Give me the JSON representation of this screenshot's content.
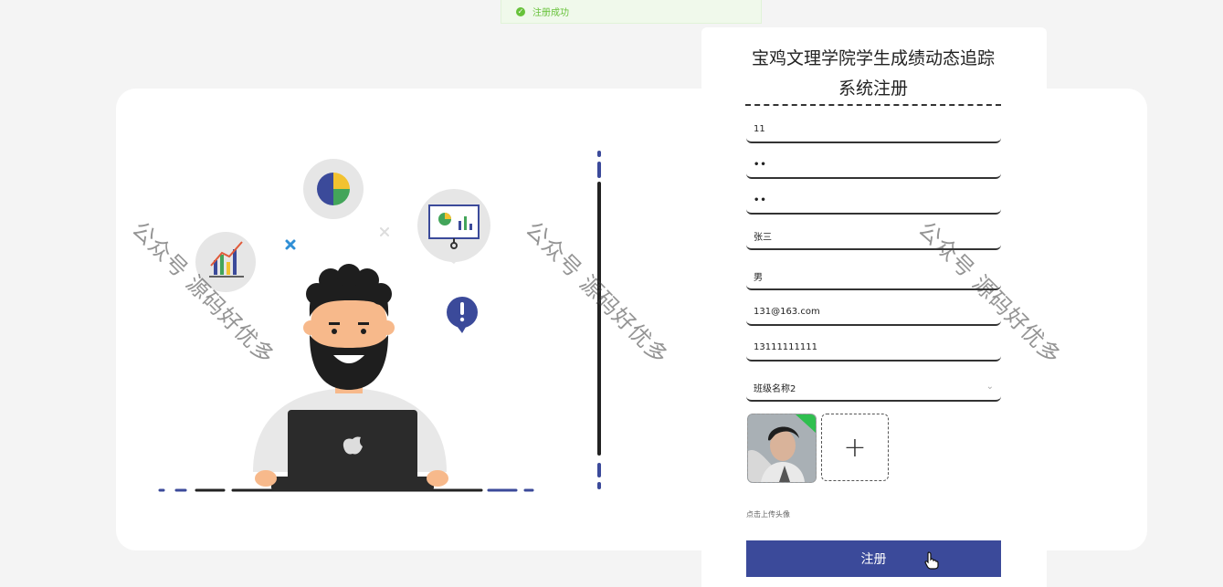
{
  "toast": {
    "text": "注册成功",
    "icon": "check-circle-icon"
  },
  "form": {
    "title": "宝鸡文理学院学生成绩动态追踪系统注册",
    "fields": [
      {
        "name": "account",
        "value": "11"
      },
      {
        "name": "password",
        "value": "••"
      },
      {
        "name": "confirm_password",
        "value": "••"
      },
      {
        "name": "real_name",
        "value": "张三"
      },
      {
        "name": "gender",
        "value": "男"
      },
      {
        "name": "email",
        "value": "131@163.com"
      },
      {
        "name": "phone",
        "value": "13111111111"
      },
      {
        "name": "class",
        "value": "班级名称2"
      }
    ],
    "upload_hint": "点击上传头像",
    "upload_plus": "+",
    "submit_label": "注册"
  },
  "watermark": {
    "text": "公众号 源码好优多"
  },
  "colors": {
    "accent": "#3b4a9a",
    "success": "#67c23a",
    "card_bg": "#ffffff",
    "page_bg": "#f4f4f4"
  }
}
